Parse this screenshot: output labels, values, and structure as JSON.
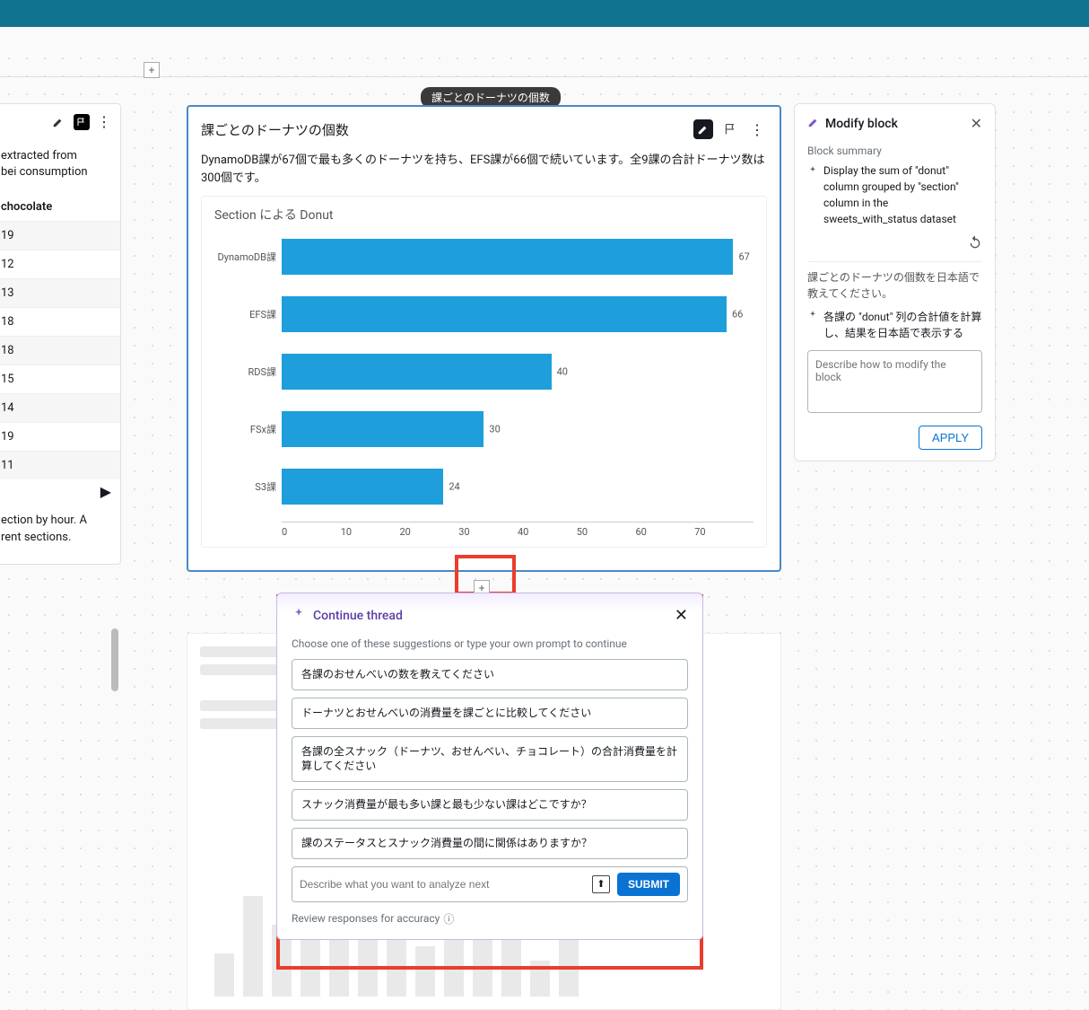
{
  "title_pill": "課ごとのドーナツの個数",
  "main_block": {
    "title": "課ごとのドーナツの個数",
    "description": "DynamoDB課が67個で最も多くのドーナツを持ち、EFS課が66個で続いています。全9課の合計ドーナツ数は300個です。",
    "chart_title": "Section による Donut"
  },
  "chart_data": {
    "type": "bar",
    "orientation": "horizontal",
    "title": "Section による Donut",
    "xlabel": "",
    "ylabel": "",
    "xlim": [
      0,
      70
    ],
    "x_ticks": [
      0,
      10,
      20,
      30,
      40,
      50,
      60,
      70
    ],
    "categories": [
      "DynamoDB課",
      "EFS課",
      "RDS課",
      "FSx課",
      "S3課"
    ],
    "values": [
      67,
      66,
      40,
      30,
      24
    ]
  },
  "left_panel": {
    "snippet1_a": " extracted from",
    "snippet1_b": "bei consumption",
    "column_header": "chocolate",
    "rows": [
      "19",
      "12",
      "13",
      "18",
      "18",
      "15",
      "14",
      "19",
      "11"
    ],
    "snippet2_a": "ection by hour. A",
    "snippet2_b": "rent sections."
  },
  "continue": {
    "title": "Continue thread",
    "hint": "Choose one of these suggestions or type your own prompt to continue",
    "suggestions": [
      "各課のおせんべいの数を教えてください",
      "ドーナツとおせんべいの消費量を課ごとに比較してください",
      "各課の全スナック（ドーナツ、おせんべい、チョコレート）の合計消費量を計算してください",
      "スナック消費量が最も多い課と最も少ない課はどこですか？",
      "課のステータスとスナック消費量の間に関係はありますか？"
    ],
    "placeholder": "Describe what you want to analyze next",
    "submit": "SUBMIT",
    "review": "Review responses for accuracy"
  },
  "modify": {
    "title": "Modify block",
    "summary_label": "Block summary",
    "summary_text": "Display the sum of \"donut\" column grouped by \"section\" column in the sweets_with_status dataset",
    "jp_request": "課ごとのドーナツの個数を日本語で教えてください。",
    "jp_plan": "各課の \"donut\" 列の合計値を計算し、結果を日本語で表示する",
    "placeholder": "Describe how to modify the block",
    "apply": "APPLY"
  }
}
